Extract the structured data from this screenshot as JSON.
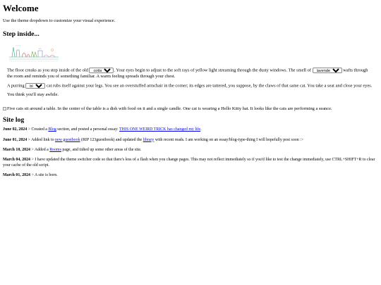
{
  "header": {
    "title": "Welcome",
    "intro": "Use the theme dropdown to customize your visual experience."
  },
  "step_inside": {
    "heading": "Step inside...",
    "p1_a": "The floor creaks as you step inside of the old",
    "theme_select": "cottage",
    "p1_b": ". Your eyes begin to adjust to the soft rays of yellow light streaming through the dusty windows. The smell of",
    "scent_select": "lavender",
    "p1_c": "wafts through the room and reminds you of something familiar. A warm feeling spreads through your chest.",
    "p2_a": "A purring",
    "cat_select": "black",
    "p2_b": "cat rubs itself against your legs. You see an overstuffed armchair in the corner; its edges are tattered, you suppose, by the claws of that same cat. You take a seat and close your eyes.",
    "p3": "You think you'll stay awhile."
  },
  "cats_image_alt": "Five cats sit around a table. In the center of the table is a dish with food on it and a single candle. One cat is wearing a Hello Kitty hat. It looks like the cats are performing a seance.",
  "site_log": {
    "heading": "Site log",
    "entries": [
      {
        "date": "June 02, 2024",
        "a": " > Created a ",
        "link1": "Blog",
        "b": " section, and posted a personal essay: ",
        "link2": "THIS ONE WEIRD TRICK has changed my life",
        "c": "."
      },
      {
        "date": "June 01, 2024",
        "a": " > Added link to ",
        "link1": "new guestbook",
        "b": " (RIP 123guestbook) and updated the ",
        "link2": "library",
        "c": " with recent reads. I am working on an essay/blog-type-thing I will hopefully post soon :>"
      },
      {
        "date": "March 10, 2024",
        "a": " > Added a ",
        "link1": "Rooms",
        "b": " page, and tidied up some other areas of the site."
      },
      {
        "date": "March 04, 2024",
        "a": " > I have updated the theme switcher code so that there's less of a flash when you change pages. This may not reflect immediately so if you'd like to test the change immediately, use CTRL+SHIFT+R to clear your cache of the old script."
      },
      {
        "date": "March 01, 2024",
        "a": " > A site is born."
      }
    ]
  }
}
